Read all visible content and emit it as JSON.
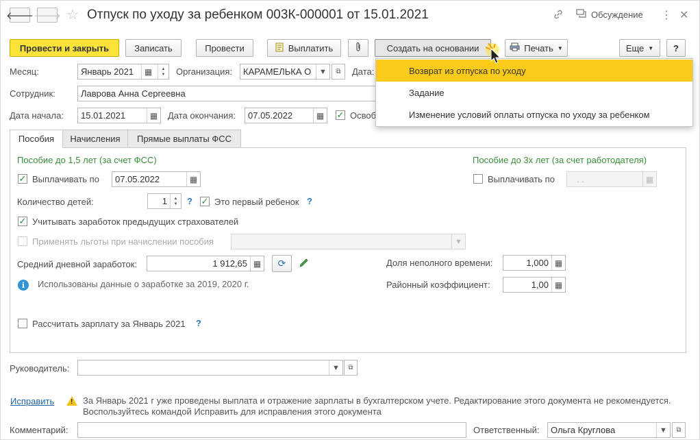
{
  "header": {
    "title": "Отпуск по уходу за ребенком 003К-000001 от 15.01.2021",
    "discussion_label": "Обсуждение"
  },
  "toolbar": {
    "post_close": "Провести и закрыть",
    "save": "Записать",
    "post": "Провести",
    "pay": "Выплатить",
    "create_based": "Создать на основании",
    "print": "Печать",
    "more": "Еще",
    "help": "?"
  },
  "dropdown": {
    "items": [
      "Возврат из отпуска по уходу",
      "Задание",
      "Изменение условий оплаты отпуска по уходу за ребенком"
    ]
  },
  "form": {
    "month_label": "Месяц:",
    "month_value": "Январь 2021",
    "org_label": "Организация:",
    "org_value": "КАРАМЕЛЬКА О",
    "date_label": "Дата:",
    "employee_label": "Сотрудник:",
    "employee_value": "Лаврова Анна Сергеевна",
    "start_label": "Дата начала:",
    "start_value": "15.01.2021",
    "end_label": "Дата окончания:",
    "end_value": "07.05.2022",
    "free_label": "Освоб"
  },
  "tabs": [
    "Пособия",
    "Начисления",
    "Прямые выплаты ФСС"
  ],
  "benefits": {
    "section_left": "Пособие до 1,5 лет (за счет ФСС)",
    "section_right": "Пособие до 3х лет (за счет работодателя)",
    "pay_until_label": "Выплачивать по",
    "pay_until_value": "07.05.2022",
    "pay_until3_label": "Выплачивать по",
    "pay_until3_value": " .  . ",
    "children_label": "Количество детей:",
    "children_value": "1",
    "first_child_label": "Это первый ребенок",
    "prev_insurers_label": "Учитывать заработок предыдущих страхователей",
    "privileges_label": "Применять льготы при начислении пособия",
    "avg_earning_label": "Средний дневной заработок:",
    "avg_earning_value": "1 912,65",
    "part_time_label": "Доля неполного времени:",
    "part_time_value": "1,000",
    "district_label": "Районный коэффициент:",
    "district_value": "1,00",
    "info_text": "Использованы данные о заработке за  2019,  2020 г.",
    "calc_salary_label": "Рассчитать зарплату за Январь 2021",
    "help_mark": "?"
  },
  "footer": {
    "manager_label": "Руководитель:",
    "manager_value": "",
    "fix_link": "Исправить",
    "warning_line1": "За Январь 2021 г уже проведены выплата и отражение зарплаты в бухгалтерском учете. Редактирование этого документа не рекомендуется.",
    "warning_line2": "Воспользуйтесь командой Исправить для исправления этого документа",
    "comment_label": "Комментарий:",
    "comment_value": "",
    "responsible_label": "Ответственный:",
    "responsible_value": "Ольга Круглова"
  }
}
